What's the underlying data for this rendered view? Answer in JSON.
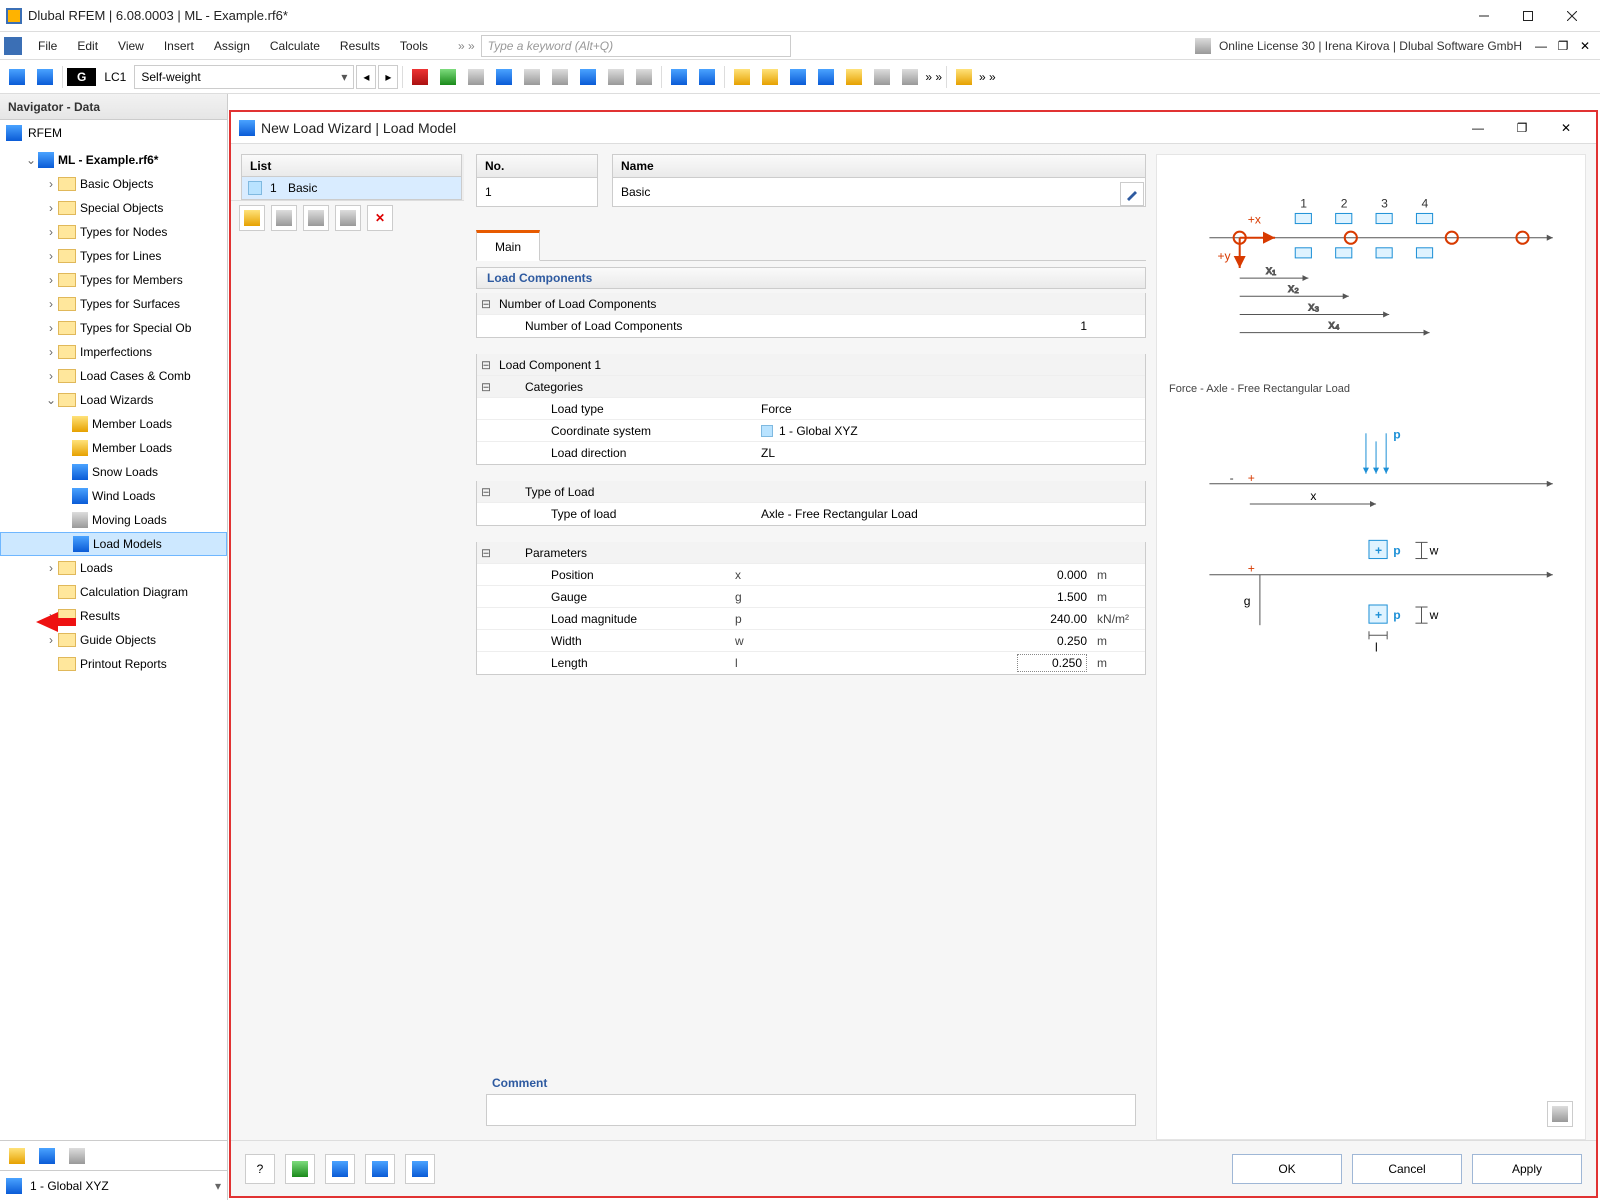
{
  "app": {
    "title": "Dlubal RFEM | 6.08.0003 | ML - Example.rf6*",
    "license": "Online License 30 | Irena Kirova | Dlubal Software GmbH"
  },
  "menu": {
    "items": [
      "File",
      "Edit",
      "View",
      "Insert",
      "Assign",
      "Calculate",
      "Results",
      "Tools"
    ],
    "search_placeholder": "Type a keyword (Alt+Q)"
  },
  "toolbar": {
    "lc_tag": "G",
    "lc_code": "LC1",
    "lc_name": "Self-weight"
  },
  "navigator": {
    "title": "Navigator - Data",
    "root": "RFEM",
    "model": "ML - Example.rf6*",
    "folders": [
      "Basic Objects",
      "Special Objects",
      "Types for Nodes",
      "Types for Lines",
      "Types for Members",
      "Types for Surfaces",
      "Types for Special Ob",
      "Imperfections",
      "Load Cases & Comb"
    ],
    "wizards_label": "Load Wizards",
    "wizards": [
      "Member Loads",
      "Member Loads",
      "Snow Loads",
      "Wind Loads",
      "Moving Loads",
      "Load Models"
    ],
    "after_wizards": [
      "Loads",
      "Calculation Diagram",
      "Results",
      "Guide Objects",
      "Printout Reports"
    ],
    "coord_sys": "1 - Global XYZ"
  },
  "dialog": {
    "title": "New Load Wizard | Load Model",
    "list_header": "List",
    "list_item_no": "1",
    "list_item_name": "Basic",
    "no_label": "No.",
    "no_value": "1",
    "name_label": "Name",
    "name_value": "Basic",
    "tab_main": "Main",
    "section_load_components": "Load Components",
    "row_num_comp_group": "Number of Load Components",
    "row_num_comp_label": "Number of Load Components",
    "row_num_comp_value": "1",
    "section_lc1": "Load Component 1",
    "row_categories": "Categories",
    "row_load_type_label": "Load type",
    "row_load_type_value": "Force",
    "row_cs_label": "Coordinate system",
    "row_cs_value": "1 - Global XYZ",
    "row_dir_label": "Load direction",
    "row_dir_value": "ZL",
    "row_type_of_load_group": "Type of Load",
    "row_type_of_load_label": "Type of load",
    "row_type_of_load_value": "Axle - Free Rectangular Load",
    "row_parameters": "Parameters",
    "params": [
      {
        "label": "Position",
        "sym": "x",
        "val": "0.000",
        "unit": "m"
      },
      {
        "label": "Gauge",
        "sym": "g",
        "val": "1.500",
        "unit": "m"
      },
      {
        "label": "Load magnitude",
        "sym": "p",
        "val": "240.00",
        "unit": "kN/m²"
      },
      {
        "label": "Width",
        "sym": "w",
        "val": "0.250",
        "unit": "m"
      },
      {
        "label": "Length",
        "sym": "l",
        "val": "0.250",
        "unit": "m"
      }
    ],
    "diagram_caption": "Force - Axle - Free Rectangular Load",
    "comment_label": "Comment",
    "btn_ok": "OK",
    "btn_cancel": "Cancel",
    "btn_apply": "Apply"
  }
}
